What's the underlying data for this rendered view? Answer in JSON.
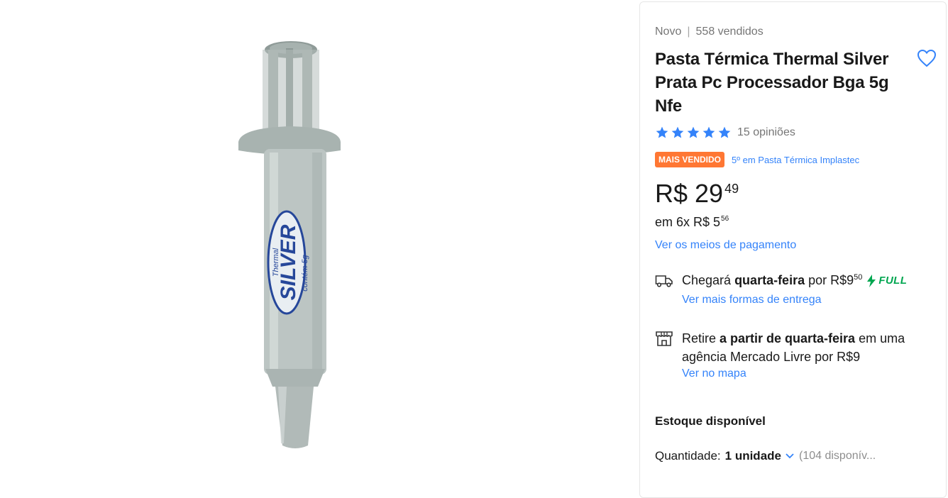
{
  "product": {
    "condition": "Novo",
    "separator": "|",
    "sold": "558 vendidos",
    "title": "Pasta Térmica Thermal Silver Prata Pc Processador Bga 5g Nfe",
    "image_label_brand": "SILVER",
    "image_label_top": "Thermal",
    "image_label_content": "contém 5g"
  },
  "rating": {
    "value": 5,
    "star_color": "#3483fa",
    "reviews": "15 opiniões"
  },
  "badge": {
    "label": "MAIS VENDIDO",
    "color": "#ff7733",
    "rank": "5º em Pasta Térmica Implastec"
  },
  "price": {
    "currency": "R$",
    "integer": "29",
    "cents": "49",
    "installments_prefix": "em 6x R$ 5",
    "installments_cents": "56",
    "payment_link": "Ver os meios de pagamento"
  },
  "shipping": {
    "icon": "truck-icon",
    "prefix": "Chegará ",
    "day": "quarta-feira",
    "middle": " por R$9",
    "cents": "50",
    "full_label": "FULL",
    "full_color": "#00a650",
    "more_link": "Ver mais formas de entrega"
  },
  "pickup": {
    "icon": "store-icon",
    "prefix": "Retire ",
    "bold": "a partir de quarta-feira",
    "suffix": " em uma agência Mercado Livre por R$9",
    "map_link": "Ver no mapa"
  },
  "stock": {
    "title": "Estoque disponível",
    "qty_label": "Quantidade:",
    "qty_value": "1 unidade",
    "available": "(104 disponív..."
  },
  "colors": {
    "link": "#3483fa",
    "accent": "#3483fa"
  }
}
